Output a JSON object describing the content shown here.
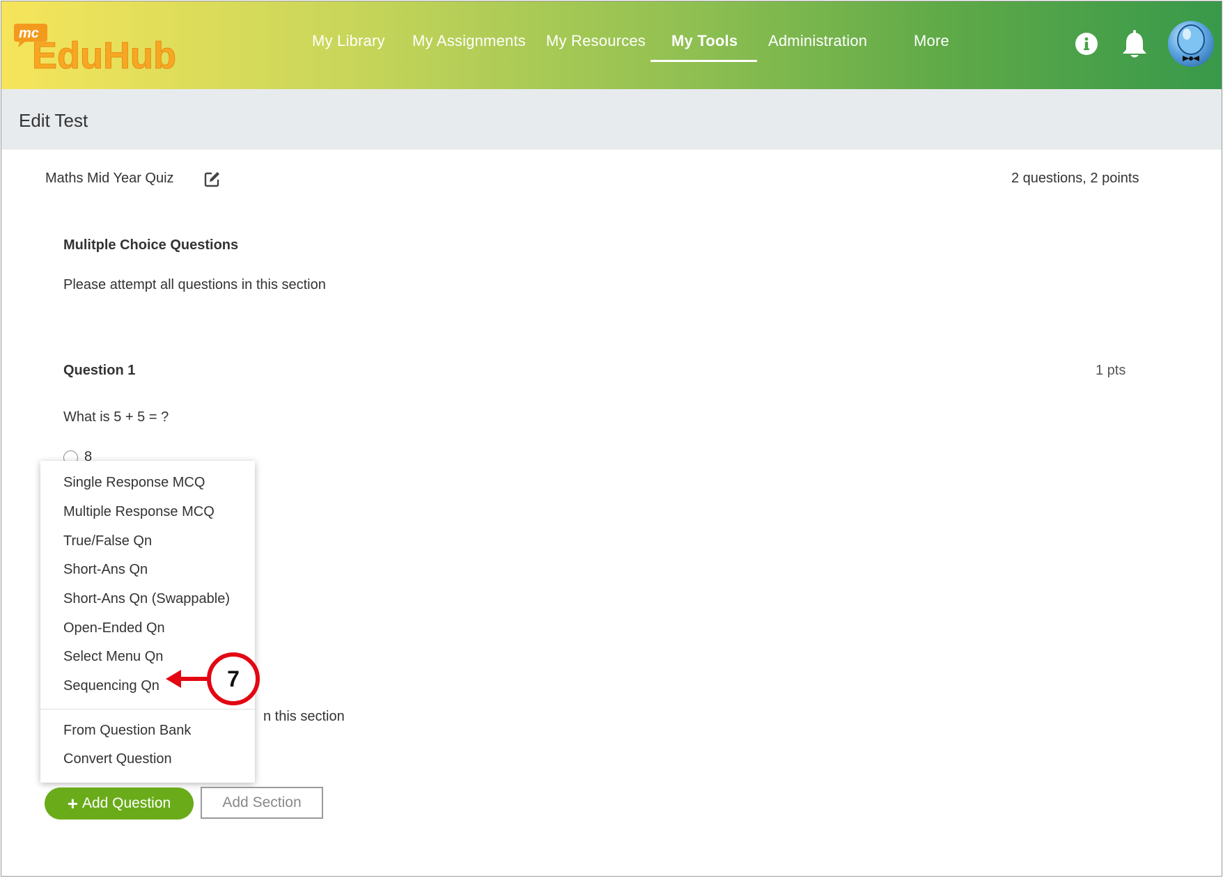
{
  "app": {
    "logo_badge": "mc",
    "logo_text": "EduHub"
  },
  "nav": {
    "items": [
      {
        "label": "My Library"
      },
      {
        "label": "My Assignments"
      },
      {
        "label": "My Resources"
      },
      {
        "label": "My Tools",
        "active": true
      },
      {
        "label": "Administration"
      },
      {
        "label": "More"
      }
    ]
  },
  "header_icons": {
    "info": "info-icon",
    "notifications": "bell-icon",
    "avatar": "avatar"
  },
  "page": {
    "title": "Edit Test"
  },
  "test": {
    "name": "Maths Mid Year Quiz",
    "summary": "2 questions, 2 points"
  },
  "sections": [
    {
      "title": "Mulitple Choice Questions",
      "description": "Please attempt all questions in this section",
      "questions": [
        {
          "title": "Question 1",
          "points": "1 pts",
          "text": "What is 5 + 5 = ?",
          "options": [
            "8"
          ]
        }
      ]
    },
    {
      "description_partial": "n this section"
    }
  ],
  "add_question_menu": {
    "items": [
      "Single Response MCQ",
      "Multiple Response MCQ",
      "True/False Qn",
      "Short-Ans Qn",
      "Short-Ans Qn (Swappable)",
      "Open-Ended Qn",
      "Select Menu Qn",
      "Sequencing Qn"
    ],
    "extra_items": [
      "From Question Bank",
      "Convert Question"
    ]
  },
  "buttons": {
    "add_question": "Add Question",
    "add_question_icon": "+",
    "add_section": "Add Section"
  },
  "callout": {
    "number": "7",
    "color": "#e30613"
  },
  "colors": {
    "accent_green": "#6aab1a",
    "header_gradient_start": "#f6e55b",
    "header_gradient_end": "#38994a",
    "logo_orange": "#f39a1e"
  }
}
